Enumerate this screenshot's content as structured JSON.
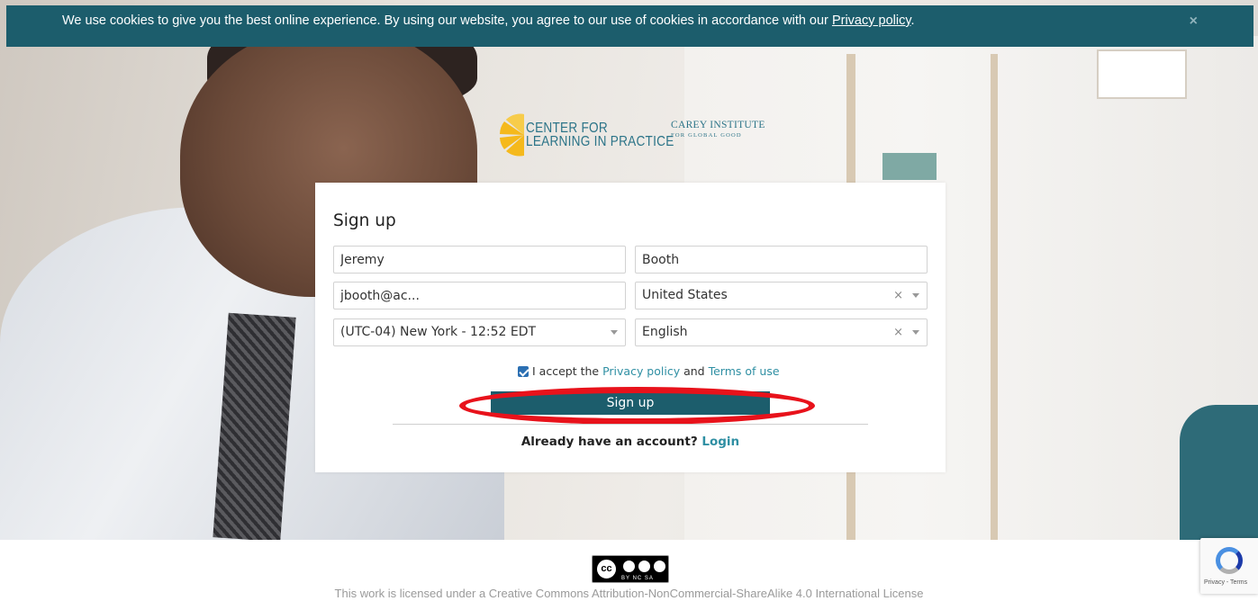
{
  "cookie_bar": {
    "message": "We use cookies to give you the best online experience. By using our website, you agree to our use of cookies in accordance with our",
    "policy_link": "Privacy policy",
    "trailing": ".",
    "close_icon": "close-icon"
  },
  "logos": {
    "clp_line1": "CENTER FOR",
    "clp_line2": "LEARNING IN PRACTICE",
    "carey_main": "CAREY INSTITUTE",
    "carey_sub": "FOR GLOBAL GOOD"
  },
  "form": {
    "title": "Sign up",
    "first_name": "Jeremy",
    "last_name": "Booth",
    "email": "jbooth@ac...",
    "country": "United States",
    "timezone": "(UTC-04) New York - 12:52 EDT",
    "language": "English",
    "clear_icon": "×",
    "accept_prefix": "I accept the",
    "privacy_link": "Privacy policy",
    "and": "and",
    "terms_link": "Terms of use",
    "accept_checked": true,
    "submit_label": "Sign up",
    "login_prompt": "Already have an account?",
    "login_link": "Login"
  },
  "footer": {
    "cc_label": "BY NC SA",
    "cc_text": "cc",
    "license_text": "This work is licensed under a Creative Commons Attribution-NonCommercial-ShareAlike 4.0 International License"
  },
  "recaptcha": {
    "label": "Privacy - Terms"
  },
  "colors": {
    "brand_teal": "#1c5d6c",
    "link_teal": "#2f8fa3",
    "highlight_red": "#e8121b"
  }
}
